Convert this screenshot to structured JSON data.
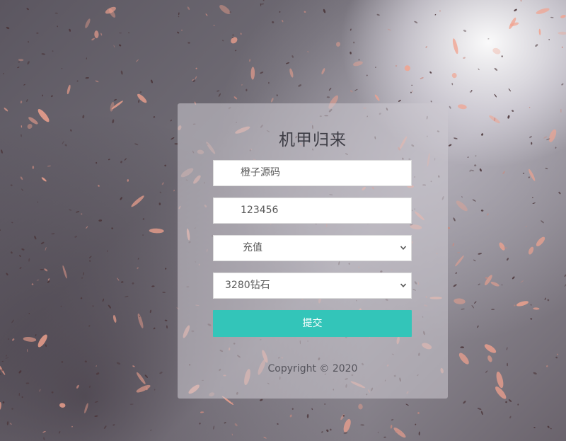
{
  "form": {
    "title": "机甲归来",
    "account_value": "橙子源码",
    "password_value": "123456",
    "type_select_value": "充值",
    "amount_select_value": "3280钻石",
    "submit_label": "提交"
  },
  "footer": {
    "copyright": "Copyright © 2020"
  },
  "colors": {
    "submit_button": "#33c5b9",
    "petal": "#f2a28e",
    "panel": "#cdcbd2"
  },
  "icons": {
    "select_arrow": "chevron-down-icon"
  }
}
